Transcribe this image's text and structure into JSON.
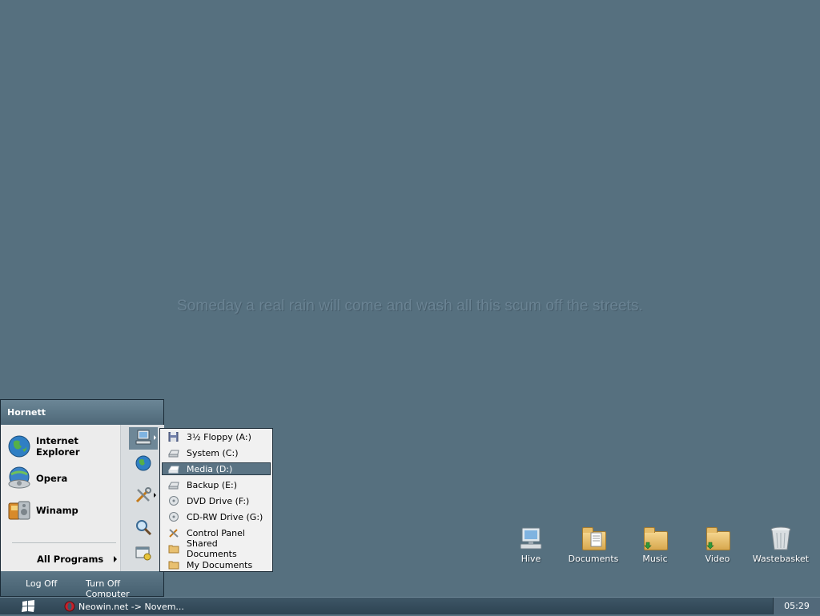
{
  "desktop": {
    "quote": "Someday a real rain will come and wash all this scum off the streets.",
    "icons": [
      {
        "label": "Hive",
        "icon": "computer-icon"
      },
      {
        "label": "Documents",
        "icon": "documents-folder-icon"
      },
      {
        "label": "Music",
        "icon": "music-folder-icon"
      },
      {
        "label": "Video",
        "icon": "video-folder-icon"
      },
      {
        "label": "Wastebasket",
        "icon": "trash-icon"
      }
    ]
  },
  "start_menu": {
    "user": "Hornett",
    "pinned": [
      {
        "label": "Internet Explorer",
        "icon": "globe-icon"
      },
      {
        "label": "Opera",
        "icon": "opera-icon"
      },
      {
        "label": "Winamp",
        "icon": "winamp-icon"
      }
    ],
    "all_programs": "All Programs",
    "side_buttons": [
      "my-computer-icon",
      "network-globe-icon",
      "tools-icon",
      "search-icon",
      "run-icon"
    ],
    "log_off": "Log Off",
    "turn_off": "Turn Off Computer"
  },
  "submenu": {
    "items": [
      {
        "label": "3½ Floppy (A:)",
        "icon": "floppy-icon"
      },
      {
        "label": "System (C:)",
        "icon": "drive-icon"
      },
      {
        "label": "Media (D:)",
        "icon": "drive-icon",
        "selected": true
      },
      {
        "label": "Backup (E:)",
        "icon": "drive-icon"
      },
      {
        "label": "DVD Drive (F:)",
        "icon": "cd-icon"
      },
      {
        "label": "CD-RW Drive (G:)",
        "icon": "cd-icon"
      },
      {
        "label": "Control Panel",
        "icon": "control-panel-icon"
      },
      {
        "label": "Shared Documents",
        "icon": "folder-icon"
      },
      {
        "label": "My Documents",
        "icon": "folder-icon"
      }
    ]
  },
  "taskbar": {
    "task_label": "Neowin.net -> Novem...",
    "clock": "05:29"
  },
  "colors": {
    "desktop": "#56707f",
    "selection": "#5b7484",
    "taskbar": "#2d4352"
  }
}
